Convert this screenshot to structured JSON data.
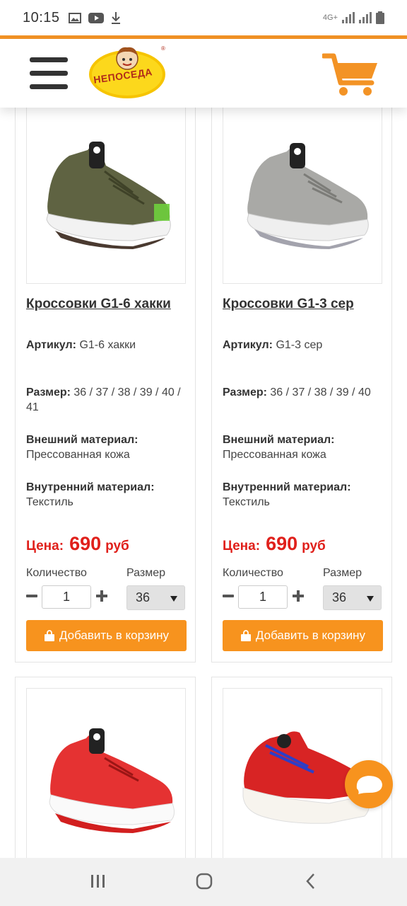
{
  "status_bar": {
    "time": "10:15",
    "network": "4G+"
  },
  "header": {
    "logo_text": "НЕПОСЕДА",
    "menu_icon": "hamburger-icon",
    "cart_icon": "shopping-cart-icon"
  },
  "colors": {
    "accent": "#f7931e",
    "price": "#e0201b",
    "text": "#333333"
  },
  "products": [
    {
      "title": "Кроссовки G1-6 хакки",
      "article_label": "Артикул:",
      "article_value": "G1-6 хакки",
      "size_label": "Размер:",
      "size_value": "36 / 37 / 38 / 39 / 40 / 41",
      "outer_label": "Внешний материал:",
      "outer_value": "Прессованная кожа",
      "inner_label": "Внутренний материал:",
      "inner_value": "Текстиль",
      "price_label": "Цена:",
      "price_value": "690",
      "price_currency": "руб",
      "qty_label": "Количество",
      "qty_value": "1",
      "size_select_label": "Размер",
      "size_selected": "36",
      "add_button": "Добавить в корзину",
      "shoe_color": "#5f6342"
    },
    {
      "title": "Кроссовки G1-3 сер",
      "article_label": "Артикул:",
      "article_value": "G1-3 сер",
      "size_label": "Размер:",
      "size_value": "36 / 37 / 38 / 39 / 40",
      "outer_label": "Внешний материал:",
      "outer_value": "Прессованная кожа",
      "inner_label": "Внутренний материал:",
      "inner_value": "Текстиль",
      "price_label": "Цена:",
      "price_value": "690",
      "price_currency": "руб",
      "qty_label": "Количество",
      "qty_value": "1",
      "size_select_label": "Размер",
      "size_selected": "36",
      "add_button": "Добавить в корзину",
      "shoe_color": "#a9a9a6"
    },
    {
      "shoe_color": "#e53232"
    },
    {
      "shoe_color": "#d82424"
    }
  ]
}
